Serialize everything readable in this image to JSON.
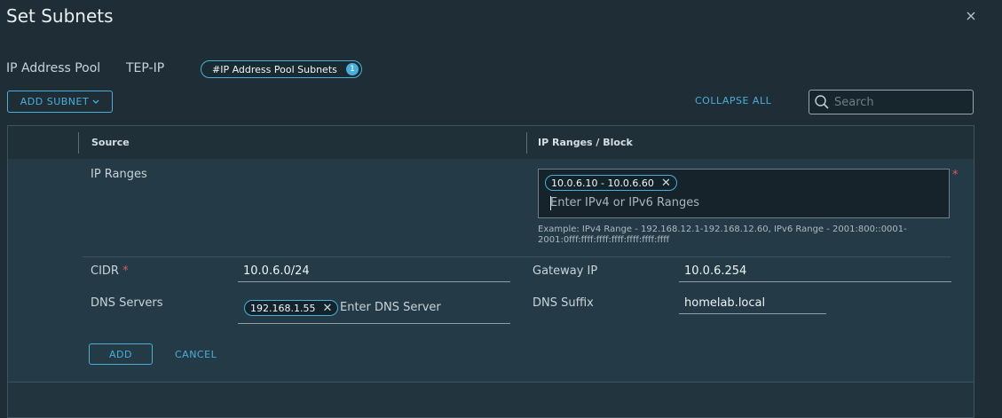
{
  "dialog": {
    "title": "Set Subnets"
  },
  "breadcrumb": {
    "pool": "IP Address Pool",
    "name": "TEP-IP",
    "tab_label": "#IP Address Pool Subnets",
    "tab_count": "1"
  },
  "toolbar": {
    "add_subnet": "ADD SUBNET",
    "collapse_all": "COLLAPSE ALL",
    "search_placeholder": "Search"
  },
  "grid": {
    "columns": [
      "Source",
      "IP Ranges / Block"
    ]
  },
  "form": {
    "source": "IP Ranges",
    "ip_range_chip": "10.0.6.10 - 10.0.6.60",
    "ip_range_placeholder": "Enter IPv4 or IPv6 Ranges",
    "help_text": "Example: IPv4 Range - 192.168.12.1-192.168.12.60, IPv6 Range - 2001:800::0001-2001:0fff:ffff:ffff:ffff:ffff:ffff:ffff",
    "cidr_label": "CIDR",
    "cidr_value": "10.0.6.0/24",
    "gateway_label": "Gateway IP",
    "gateway_value": "10.0.6.254",
    "dns_servers_label": "DNS Servers",
    "dns_server_chip": "192.168.1.55",
    "dns_server_placeholder": "Enter DNS Server",
    "dns_suffix_label": "DNS Suffix",
    "dns_suffix_value": "homelab.local",
    "required_mark": "*",
    "add_label": "ADD",
    "cancel_label": "CANCEL"
  },
  "colors": {
    "accent": "#49afd9",
    "background": "#1f2e36",
    "required": "#e05a5a"
  }
}
